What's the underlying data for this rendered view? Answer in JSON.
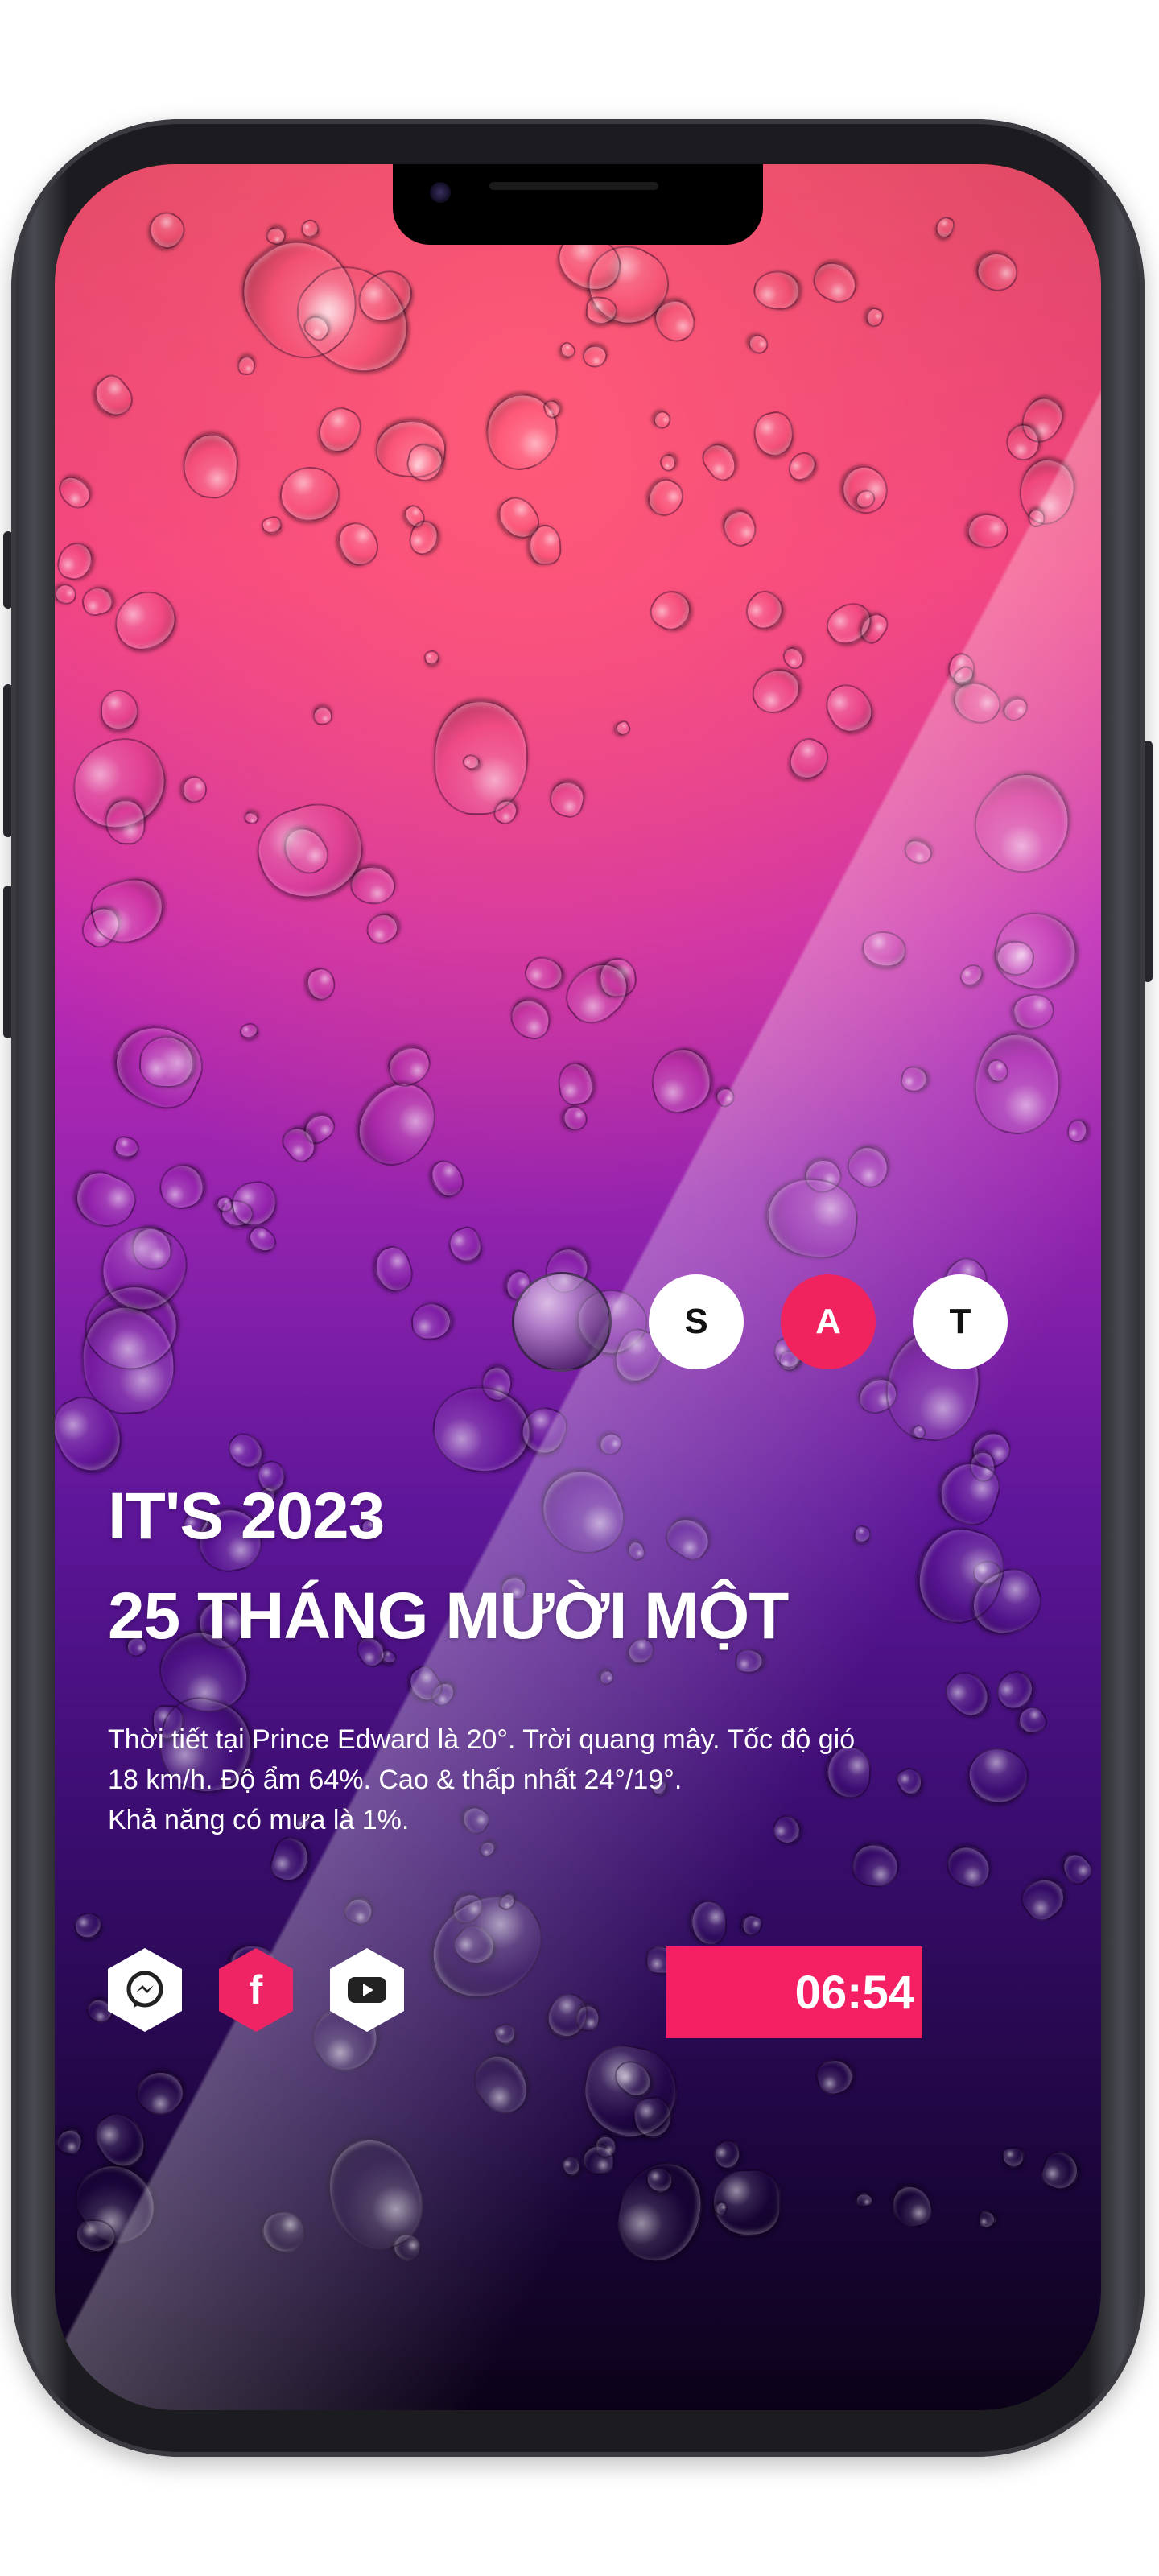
{
  "weekday": {
    "letters": [
      "S",
      "A",
      "T"
    ],
    "active_letter": "A"
  },
  "headline": {
    "year_line": "IT'S 2023",
    "date_line": "25 THÁNG MƯỜI MỘT"
  },
  "weather": {
    "line1": "Thời tiết tại Prince Edward là 20°. Trời quang mây. Tốc độ gió",
    "line2": "18 km/h. Độ ẩm 64%. Cao & thấp nhất 24°/19°.",
    "line3": "Khả năng có mưa là 1%."
  },
  "social": {
    "icons": [
      "messenger-icon",
      "facebook-icon",
      "youtube-icon"
    ],
    "facebook_glyph": "f"
  },
  "clock": {
    "time": "06:54"
  },
  "colors": {
    "accent": "#f51f63",
    "text": "#ffffff",
    "frame": "#1c1c20"
  }
}
